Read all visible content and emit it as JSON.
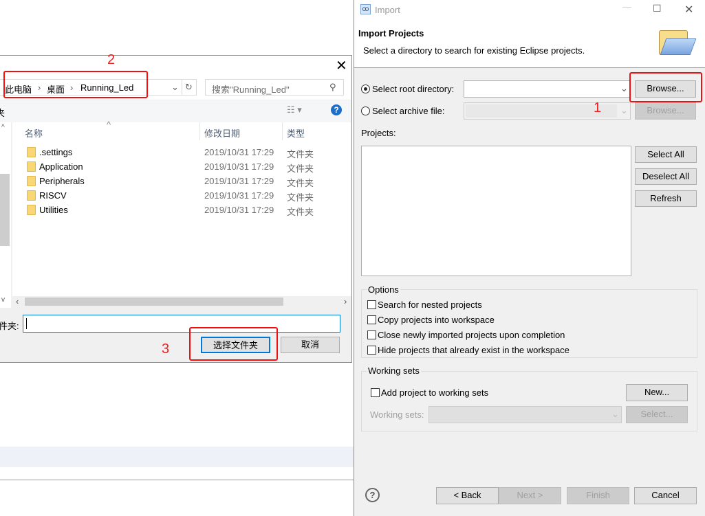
{
  "background": {
    "band_color": "#eef2f8"
  },
  "folder_dialog": {
    "breadcrumb": [
      "此电脑",
      "桌面",
      "Running_Led"
    ],
    "search_placeholder": "搜索\"Running_Led\"",
    "toolbar_left_fragment": "夹",
    "columns": [
      "名称",
      "修改日期",
      "类型"
    ],
    "rows": [
      {
        "name": ".settings",
        "date": "2019/10/31 17:29",
        "type": "文件夹"
      },
      {
        "name": "Application",
        "date": "2019/10/31 17:29",
        "type": "文件夹"
      },
      {
        "name": "Peripherals",
        "date": "2019/10/31 17:29",
        "type": "文件夹"
      },
      {
        "name": "RISCV",
        "date": "2019/10/31 17:29",
        "type": "文件夹"
      },
      {
        "name": "Utilities",
        "date": "2019/10/31 17:29",
        "type": "文件夹"
      }
    ],
    "folder_label": "件夹:",
    "folder_value": "",
    "select_button": "选择文件夹",
    "cancel_button": "取消"
  },
  "annotations": {
    "n1": "1",
    "n2": "2",
    "n3": "3",
    "color": "#f01010"
  },
  "import_dialog": {
    "title": "Import",
    "header_title": "Import Projects",
    "header_desc": "Select a directory to search for existing Eclipse projects.",
    "root_dir_label": "Select root directory:",
    "root_dir_selected": true,
    "archive_label": "Select archive file:",
    "browse": "Browse...",
    "projects_label": "Projects:",
    "select_all": "Select All",
    "deselect_all": "Deselect All",
    "refresh": "Refresh",
    "options_title": "Options",
    "options": [
      "Search for nested projects",
      "Copy projects into workspace",
      "Close newly imported projects upon completion",
      "Hide projects that already exist in the workspace"
    ],
    "working_sets_title": "Working sets",
    "add_to_ws": "Add project to working sets",
    "new": "New...",
    "ws_label": "Working sets:",
    "select": "Select...",
    "back": "< Back",
    "next": "Next >",
    "finish": "Finish",
    "cancel": "Cancel"
  }
}
